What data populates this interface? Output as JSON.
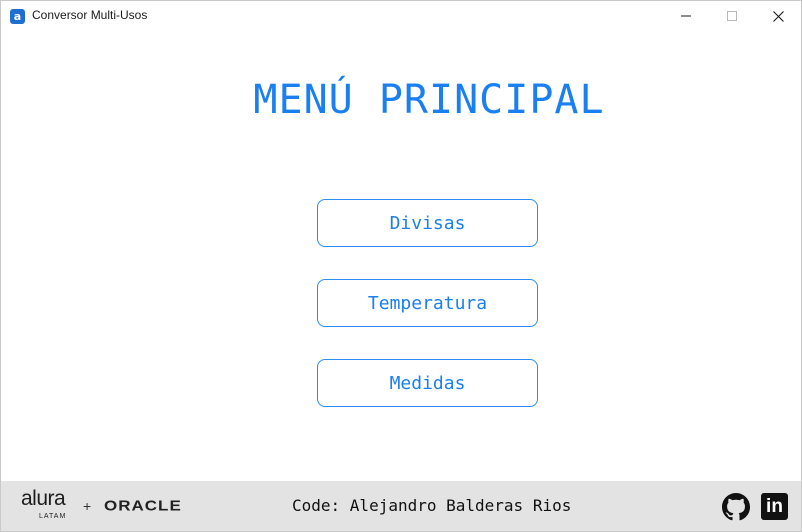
{
  "window": {
    "title": "Conversor Multi-Usos",
    "app_icon": "a",
    "controls": [
      "minimize-icon",
      "maximize-icon",
      "close-icon"
    ]
  },
  "main": {
    "heading": "MENÚ PRINCIPAL",
    "buttons": [
      {
        "label": "Divisas"
      },
      {
        "label": "Temperatura"
      },
      {
        "label": "Medidas"
      }
    ]
  },
  "footer": {
    "alura": "alura",
    "alura_sub": "LATAM",
    "plus": "+",
    "oracle": "ORACLE",
    "credit": "Code: Alejandro Balderas Rios",
    "linkedin_glyph": "in",
    "icons": [
      "github-icon",
      "linkedin-icon"
    ]
  },
  "colors": {
    "accent": "#1a7ff0",
    "button_border": "#2d8cf0",
    "footer_bg": "#e3e3e3",
    "app_icon": "#1f6fd1"
  }
}
